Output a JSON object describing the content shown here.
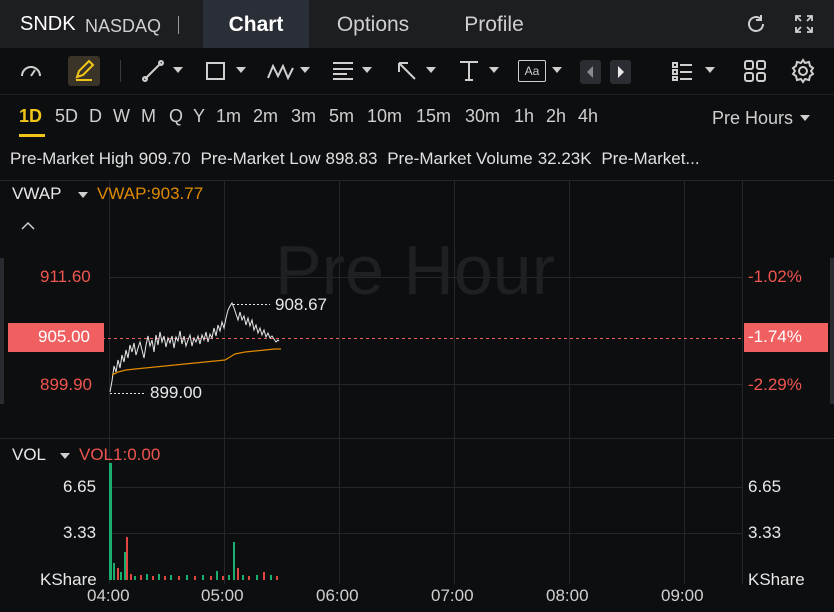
{
  "header": {
    "ticker": "SNDK",
    "exchange": "NASDAQ",
    "tabs": [
      {
        "label": "Chart",
        "active": true
      },
      {
        "label": "Options",
        "active": false
      },
      {
        "label": "Profile",
        "active": false
      }
    ]
  },
  "toolbar": {
    "icons": [
      "gauge-icon",
      "pen-icon",
      "line-tool-icon",
      "rectangle-tool-icon",
      "pattern-tool-icon",
      "fib-tool-icon",
      "arrow-tool-icon",
      "ruler-tool-icon",
      "text-tool-icon",
      "step-back-icon",
      "step-forward-icon",
      "list-icon",
      "grid-icon",
      "settings-icon"
    ],
    "text_tool_label": "Aa"
  },
  "intervals": [
    "1D",
    "5D",
    "D",
    "W",
    "M",
    "Q",
    "Y",
    "1m",
    "2m",
    "3m",
    "5m",
    "10m",
    "15m",
    "30m",
    "1h",
    "2h",
    "4h"
  ],
  "active_interval": "1D",
  "session_selector": "Pre Hours",
  "premarket": {
    "high_label": "Pre-Market High",
    "high": "909.70",
    "low_label": "Pre-Market Low",
    "low": "898.83",
    "volume_label": "Pre-Market Volume",
    "volume": "32.23K",
    "more_label": "Pre-Market..."
  },
  "price_panel": {
    "indicator": "VWAP",
    "indicator_value": "VWAP:903.77",
    "watermark": "Pre Hour",
    "left_ticks": [
      "911.60",
      "899.90"
    ],
    "current_price": "905.00",
    "right_ticks": [
      "-1.02%",
      "-2.29%"
    ],
    "current_pct": "-1.74%",
    "high_marker": "908.67",
    "low_marker": "899.00",
    "colors": {
      "price_line": "#e8e8e8",
      "vwap_line": "#e08a00",
      "down": "#f04b4b",
      "current_bg": "#f06060"
    }
  },
  "volume_panel": {
    "indicator": "VOL",
    "indicator_value": "VOL1:0.00",
    "left_ticks": [
      "6.65",
      "3.33"
    ],
    "right_ticks": [
      "6.65",
      "3.33"
    ],
    "unit": "KShare",
    "colors": {
      "up": "#1aaf6e",
      "down": "#e0483f"
    }
  },
  "x_axis": [
    "04:00",
    "05:00",
    "06:00",
    "07:00",
    "08:00",
    "09:00"
  ]
}
